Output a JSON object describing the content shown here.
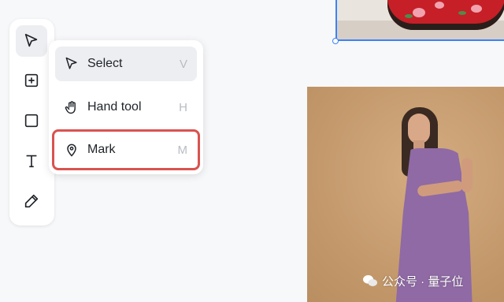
{
  "toolbar": {
    "tools": [
      {
        "name": "select-tool",
        "icon": "cursor-arrow-icon",
        "active": true
      },
      {
        "name": "frame-tool",
        "icon": "plus-square-icon",
        "active": false
      },
      {
        "name": "rectangle-tool",
        "icon": "square-icon",
        "active": false
      },
      {
        "name": "text-tool",
        "icon": "text-t-icon",
        "active": false
      },
      {
        "name": "pen-tool",
        "icon": "pencil-icon",
        "active": false
      }
    ]
  },
  "menu": {
    "items": [
      {
        "label": "Select",
        "shortcut": "V",
        "icon": "cursor-arrow-icon",
        "selected": true
      },
      {
        "label": "Hand tool",
        "shortcut": "H",
        "icon": "hand-icon",
        "selected": false
      },
      {
        "label": "Mark",
        "shortcut": "M",
        "icon": "map-pin-icon",
        "selected": false,
        "highlighted": true
      }
    ]
  },
  "watermark": {
    "text": "公众号 · 量子位",
    "icon": "wechat-icon"
  },
  "colors": {
    "selection": "#3b82f6",
    "highlight": "#d9534f",
    "active_bg": "#eceef1",
    "canvas": "#f7f8fa"
  }
}
